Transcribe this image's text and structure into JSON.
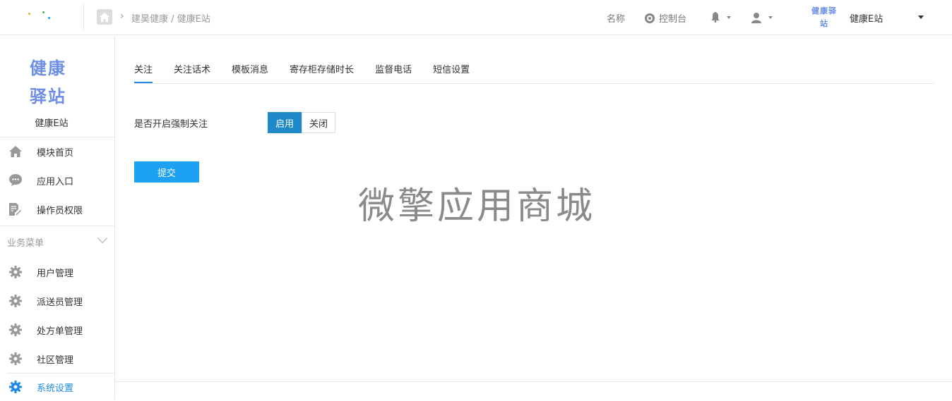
{
  "header": {
    "breadcrumb": "建昊健康 / 健康E站",
    "name_label": "名称",
    "console_label": "控制台",
    "store_logo_text": "健康驿站",
    "store_name": "健康E站"
  },
  "sidebar": {
    "logo_line1": "健康",
    "logo_line2": "驿站",
    "store_name": "健康E站",
    "top_items": [
      {
        "label": "模块首页",
        "icon": "home-icon"
      },
      {
        "label": "应用入口",
        "icon": "chat-icon"
      },
      {
        "label": "操作员权限",
        "icon": "document-edit-icon"
      }
    ],
    "section_title": "业务菜单",
    "business_items": [
      {
        "label": "用户管理",
        "icon": "gear-icon"
      },
      {
        "label": "派送员管理",
        "icon": "gear-icon"
      },
      {
        "label": "处方单管理",
        "icon": "gear-icon"
      },
      {
        "label": "社区管理",
        "icon": "gear-icon"
      },
      {
        "label": "系统设置",
        "icon": "gear-icon",
        "active": true
      }
    ]
  },
  "main": {
    "tabs": [
      "关注",
      "关注话术",
      "模板消息",
      "寄存柜存储时长",
      "监督电话",
      "短信设置"
    ],
    "form": {
      "label": "是否开启强制关注",
      "enable_label": "启用",
      "disable_label": "关闭",
      "selected": "启用"
    },
    "submit_label": "提交",
    "watermark": "微擎应用商城"
  },
  "colors": {
    "accent": "#1e88e5",
    "primary_button": "#1da1f2",
    "toggle_on": "#1e88c8",
    "logo": "#6d8ee6"
  }
}
